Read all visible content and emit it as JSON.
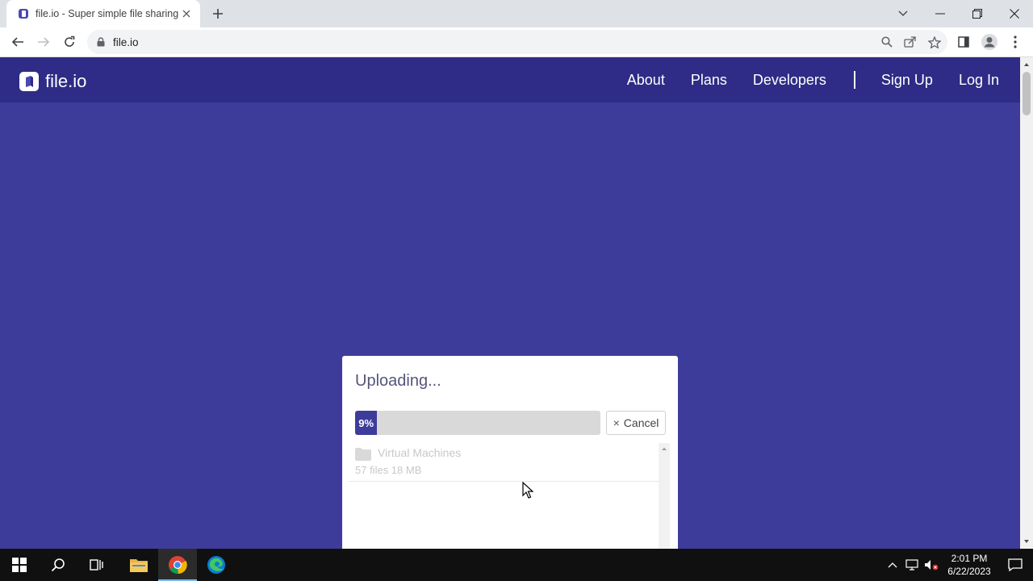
{
  "browser": {
    "tab_title": "file.io - Super simple file sharing",
    "url": "file.io",
    "icons": [
      "favicon-icon",
      "close-icon",
      "new-tab-icon",
      "chevron-down-icon",
      "minimize-icon",
      "restore-icon",
      "window-close-icon",
      "back-icon",
      "forward-icon",
      "reload-icon",
      "lock-icon",
      "zoom-icon",
      "share-icon",
      "star-icon",
      "side-panel-icon",
      "profile-icon",
      "menu-icon"
    ]
  },
  "header": {
    "logo_text": "file.io",
    "nav": [
      "About",
      "Plans",
      "Developers",
      "Sign Up",
      "Log In"
    ]
  },
  "upload": {
    "title": "Uploading...",
    "progress": 0.09,
    "progress_label": "9%",
    "cancel_label": "Cancel",
    "cancel_icon": "×",
    "files": [
      {
        "name": "Virtual Machines",
        "meta": "57 files 18 MB",
        "icon": "folder-icon"
      }
    ]
  },
  "taskbar": {
    "time": "2:01 PM",
    "date": "6/22/2023",
    "items": [
      "start-icon",
      "search-icon",
      "task-view-icon",
      "file-explorer-icon",
      "chrome-icon",
      "edge-icon"
    ]
  },
  "colors": {
    "accent": "#3e3c9b",
    "header": "#2e2c86"
  }
}
